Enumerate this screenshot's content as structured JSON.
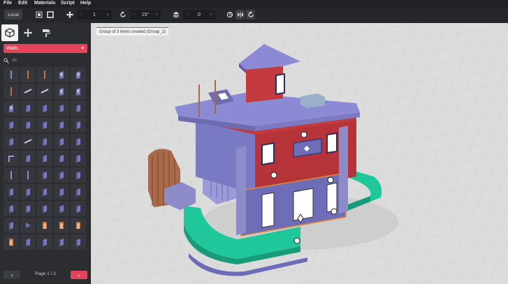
{
  "menu": {
    "file": "File",
    "edit": "Edit",
    "materials": "Materials",
    "script": "Script",
    "help": "Help"
  },
  "toolbar": {
    "space_label": "Local",
    "move_step": "1",
    "rotate_step": "15°",
    "layer_value": "0",
    "minus": "−",
    "plus": "+"
  },
  "sidebar": {
    "category": "Walls",
    "search_placeholder": "All",
    "page_label": "Page 1 / 2",
    "prev": "‹",
    "next": "›"
  },
  "status": {
    "toast": "Group of 3 items created (Group_2)"
  },
  "colors": {
    "accent": "#e64259",
    "panel": "#2b2d31",
    "viewport": "#dadada"
  }
}
